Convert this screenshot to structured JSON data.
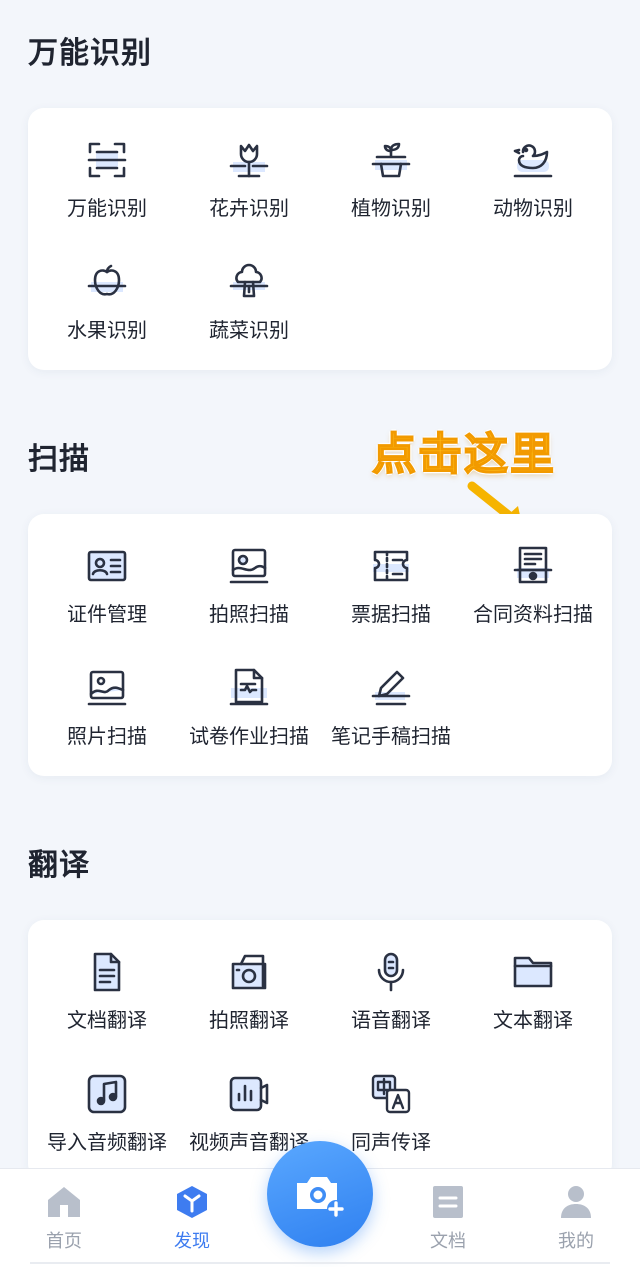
{
  "sections": [
    {
      "title": "万能识别",
      "items": [
        {
          "label": "万能识别",
          "icon": "scan-frame-icon"
        },
        {
          "label": "花卉识别",
          "icon": "flower-icon"
        },
        {
          "label": "植物识别",
          "icon": "plant-pot-icon"
        },
        {
          "label": "动物识别",
          "icon": "duck-icon"
        },
        {
          "label": "水果识别",
          "icon": "apple-icon"
        },
        {
          "label": "蔬菜识别",
          "icon": "broccoli-icon"
        }
      ]
    },
    {
      "title": "扫描",
      "items": [
        {
          "label": "证件管理",
          "icon": "id-card-icon"
        },
        {
          "label": "拍照扫描",
          "icon": "photo-scan-icon"
        },
        {
          "label": "票据扫描",
          "icon": "ticket-icon"
        },
        {
          "label": "合同资料扫描",
          "icon": "contract-icon"
        },
        {
          "label": "照片扫描",
          "icon": "picture-icon"
        },
        {
          "label": "试卷作业扫描",
          "icon": "exam-paper-icon"
        },
        {
          "label": "笔记手稿扫描",
          "icon": "pen-note-icon"
        }
      ]
    },
    {
      "title": "翻译",
      "items": [
        {
          "label": "文档翻译",
          "icon": "document-icon"
        },
        {
          "label": "拍照翻译",
          "icon": "camera-translate-icon"
        },
        {
          "label": "语音翻译",
          "icon": "microphone-icon"
        },
        {
          "label": "文本翻译",
          "icon": "folder-icon"
        },
        {
          "label": "导入音频翻译",
          "icon": "music-note-icon"
        },
        {
          "label": "视频声音翻译",
          "icon": "video-audio-icon"
        },
        {
          "label": "同声传译",
          "icon": "zh-a-translate-icon"
        }
      ]
    }
  ],
  "hint": {
    "text": "点击这里",
    "color": "#ffc21a"
  },
  "tabbar": {
    "items": [
      {
        "label": "首页",
        "icon": "home-icon",
        "active": false
      },
      {
        "label": "发现",
        "icon": "discover-cube-icon",
        "active": true
      },
      {
        "label": "文档",
        "icon": "document-tab-icon",
        "active": false
      },
      {
        "label": "我的",
        "icon": "profile-icon",
        "active": false
      }
    ],
    "center_button": {
      "icon": "camera-plus-icon"
    }
  },
  "colors": {
    "accent": "#3e7cf0",
    "icon_stroke": "#2a3142",
    "icon_fill": "#dce8ff"
  }
}
